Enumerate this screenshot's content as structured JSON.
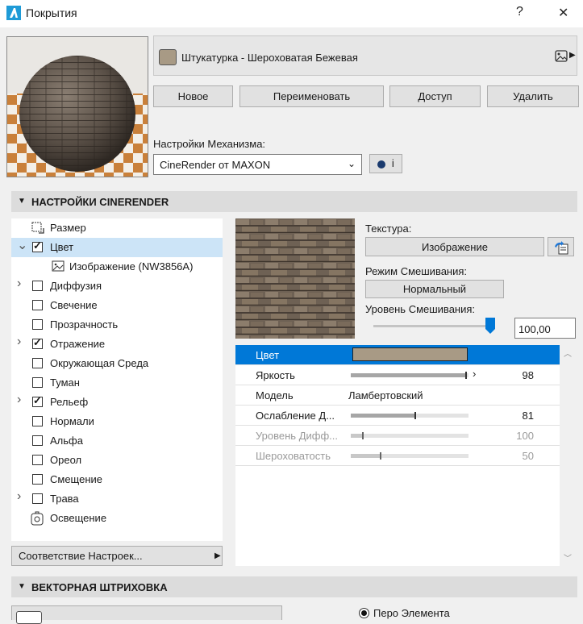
{
  "window": {
    "title": "Покрытия",
    "help": "?",
    "close": "✕"
  },
  "material": {
    "name": "Штукатурка - Шероховатая Бежевая",
    "swatch_color": "#a89a85"
  },
  "buttons": {
    "new": "Новое",
    "rename": "Переименовать",
    "access": "Доступ",
    "delete": "Удалить"
  },
  "engine": {
    "label": "Настройки Механизма:",
    "value": "CineRender от MAXON",
    "info": "i"
  },
  "cinerender": {
    "header": "НАСТРОЙКИ CINERENDER",
    "tree": [
      {
        "label": "Размер",
        "type": "icon",
        "icon": "size-icon"
      },
      {
        "label": "Цвет",
        "type": "check",
        "checked": true,
        "expand": "open",
        "selected": true
      },
      {
        "label": "Изображение (NW3856A)",
        "type": "subicon",
        "icon": "image-icon"
      },
      {
        "label": "Диффузия",
        "type": "check",
        "checked": false,
        "expand": "closed"
      },
      {
        "label": "Свечение",
        "type": "check",
        "checked": false
      },
      {
        "label": "Прозрачность",
        "type": "check",
        "checked": false
      },
      {
        "label": "Отражение",
        "type": "check",
        "checked": true,
        "expand": "closed"
      },
      {
        "label": "Окружающая Среда",
        "type": "check",
        "checked": false
      },
      {
        "label": "Туман",
        "type": "check",
        "checked": false
      },
      {
        "label": "Рельеф",
        "type": "check",
        "checked": true,
        "expand": "closed"
      },
      {
        "label": "Нормали",
        "type": "check",
        "checked": false
      },
      {
        "label": "Альфа",
        "type": "check",
        "checked": false
      },
      {
        "label": "Ореол",
        "type": "check",
        "checked": false
      },
      {
        "label": "Смещение",
        "type": "check",
        "checked": false
      },
      {
        "label": "Трава",
        "type": "check",
        "checked": false,
        "expand": "closed"
      },
      {
        "label": "Освещение",
        "type": "icon",
        "icon": "lighting-icon"
      }
    ],
    "match_settings": "Соответствие Настроек...",
    "texture_label": "Текстура:",
    "texture_button": "Изображение",
    "blend_mode_label": "Режим Смешивания:",
    "blend_mode_value": "Нормальный",
    "blend_level_label": "Уровень Смешивания:",
    "blend_level_value": "100,00",
    "blend_level_fraction": 1.0,
    "properties": [
      {
        "name": "Цвет",
        "kind": "color",
        "color": "#a89a85",
        "selected": true
      },
      {
        "name": "Яркость",
        "kind": "slider",
        "value": "98",
        "fraction": 0.98,
        "arrow": true
      },
      {
        "name": "Модель",
        "kind": "text",
        "text": "Ламбертовский"
      },
      {
        "name": "Ослабление Д...",
        "kind": "slider",
        "value": "81",
        "fraction": 0.55
      },
      {
        "name": "Уровень Дифф...",
        "kind": "slider",
        "value": "100",
        "fraction": 0.1,
        "disabled": true
      },
      {
        "name": "Шероховатость",
        "kind": "slider",
        "value": "50",
        "fraction": 0.25,
        "disabled": true
      }
    ]
  },
  "vector": {
    "header": "ВЕКТОРНАЯ ШТРИХОВКА",
    "pen_label": "Перо Элемента"
  }
}
